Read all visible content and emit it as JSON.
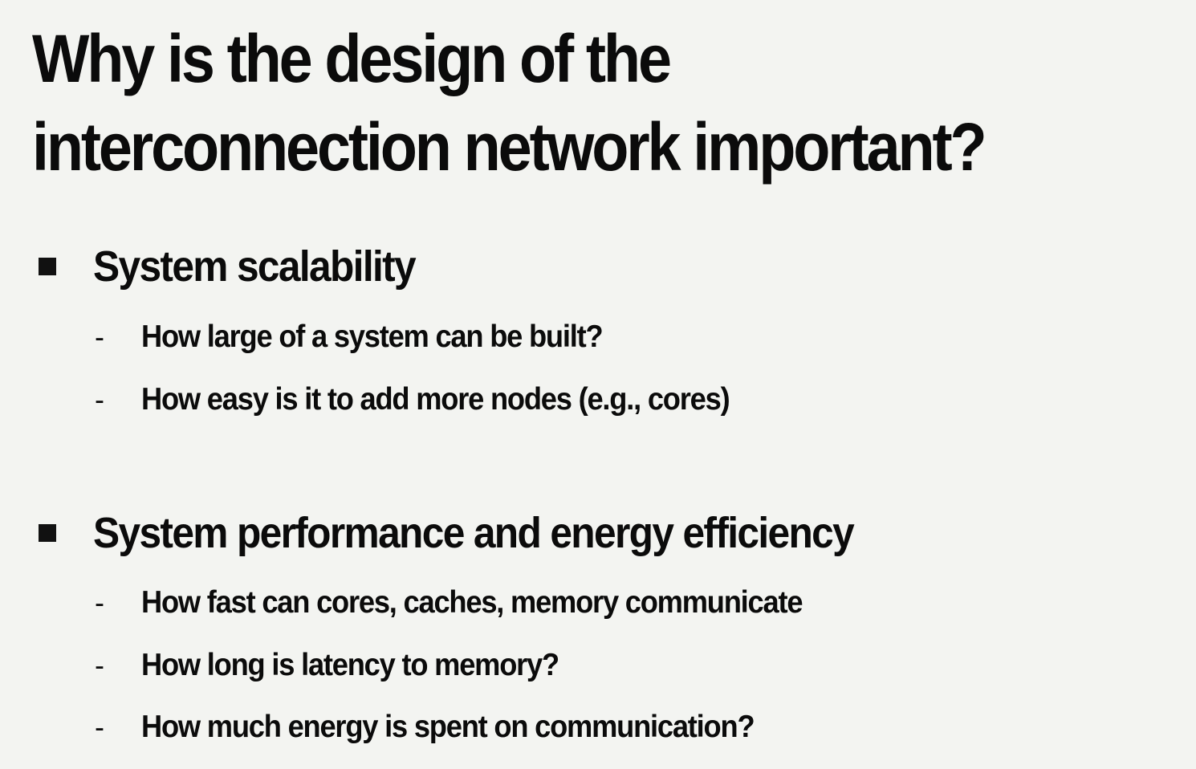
{
  "slide": {
    "title": "Why is the design of the interconnection network important?",
    "sections": [
      {
        "heading": "System scalability",
        "items": [
          "How large of a system can be built?",
          "How easy is it to add more nodes (e.g., cores)"
        ]
      },
      {
        "heading": "System performance and energy efficiency",
        "items": [
          "How fast can cores, caches, memory communicate",
          "How long is latency to memory?",
          "How much energy is spent on communication?"
        ]
      }
    ],
    "dash": "-"
  }
}
